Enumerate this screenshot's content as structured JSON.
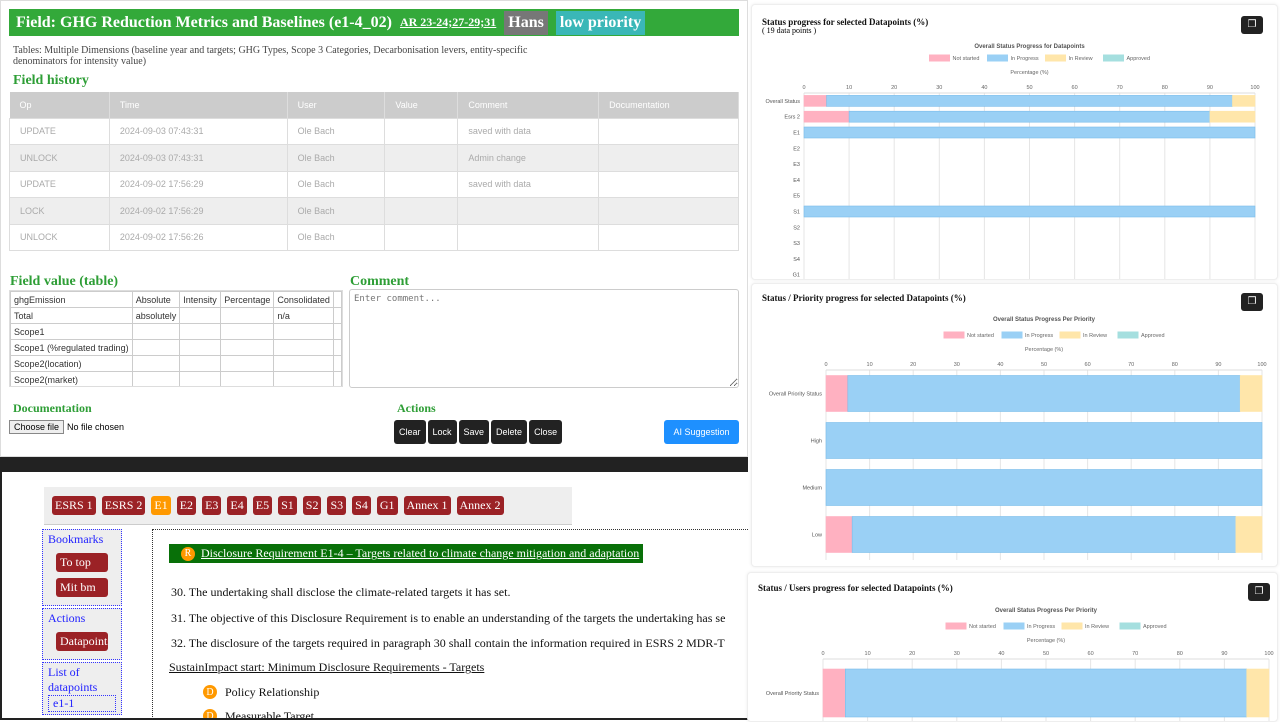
{
  "field": {
    "title": "Field: GHG Reduction Metrics and Baselines (e1-4_02)",
    "ar_ref": "AR 23-24;27-29;31",
    "user_badge": "Hans",
    "priority_badge": "low priority",
    "description": "Tables: Multiple Dimensions (baseline year and targets; GHG Types, Scope 3 Categories, Decarbonisation levers, entity-specific denominators for intensity value)"
  },
  "history": {
    "heading": "Field history",
    "columns": [
      "Op",
      "Time",
      "User",
      "Value",
      "Comment",
      "Documentation"
    ],
    "rows": [
      [
        "UPDATE",
        "2024-09-03 07:43:31",
        "Ole Bach",
        "",
        "saved with data",
        ""
      ],
      [
        "UNLOCK",
        "2024-09-03 07:43:31",
        "Ole Bach",
        "",
        "Admin change",
        ""
      ],
      [
        "UPDATE",
        "2024-09-02 17:56:29",
        "Ole Bach",
        "",
        "saved with data",
        ""
      ],
      [
        "LOCK",
        "2024-09-02 17:56:29",
        "Ole Bach",
        "",
        "",
        ""
      ],
      [
        "UNLOCK",
        "2024-09-02 17:56:26",
        "Ole Bach",
        "",
        "",
        ""
      ]
    ]
  },
  "value_table": {
    "heading": "Field value (table)",
    "rows": [
      [
        "ghgEmission",
        "Absolute",
        "Intensity",
        "Percentage",
        "Consolidated",
        ""
      ],
      [
        "Total",
        "absolutely",
        "",
        "",
        "n/a",
        ""
      ],
      [
        "Scope1",
        "",
        "",
        "",
        "",
        ""
      ],
      [
        "Scope1 (%regulated trading)",
        "",
        "",
        "",
        "",
        ""
      ],
      [
        "Scope2(location)",
        "",
        "",
        "",
        "",
        ""
      ],
      [
        "Scope2(market)",
        "",
        "",
        "",
        "",
        ""
      ]
    ]
  },
  "comment": {
    "heading": "Comment",
    "placeholder": "Enter comment..."
  },
  "documentation": {
    "heading": "Documentation",
    "choose_file": "Choose file",
    "no_file": "No file chosen"
  },
  "actions": {
    "heading": "Actions",
    "buttons": [
      "Clear",
      "Lock",
      "Save",
      "Delete",
      "Close"
    ],
    "ai": "AI Suggestion"
  },
  "nav": {
    "tabs": [
      "ESRS 1",
      "ESRS 2",
      "E1",
      "E2",
      "E3",
      "E4",
      "E5",
      "S1",
      "S2",
      "S3",
      "S4",
      "G1",
      "Annex 1",
      "Annex 2"
    ],
    "active": "E1"
  },
  "sidebar": {
    "bookmarks": "Bookmarks",
    "to_top": "To top",
    "mit_bm": "Mit bm",
    "actions": "Actions",
    "datapoints": "Datapoints",
    "list": "List of datapoints",
    "first_dp": "e1-1"
  },
  "document": {
    "requirement_marker": "R",
    "requirement": "Disclosure Requirement E1-4 – Targets related to climate change mitigation and adaptation",
    "paragraphs": [
      "30.  The undertaking shall disclose the climate-related targets it has set.",
      "31.  The objective of this Disclosure Requirement is to enable an understanding of the targets the undertaking has se",
      "32.  The disclosure of the targets required in paragraph 30 shall contain the information required in ESRS 2 MDR-T"
    ],
    "section": "SustainImpact start: Minimum Disclosure Requirements - Targets",
    "dp_marker": "D",
    "items": [
      "Policy Relationship",
      "Measurable Target"
    ]
  },
  "chart_data": [
    {
      "type": "bar",
      "orientation": "horizontal",
      "stacked": true,
      "card_title": "Status progress for selected Datapoints (%)",
      "subtitle": "( 19 data points )",
      "title": "Overall Status Progress for Datapoints",
      "xlabel": "Percentage (%)",
      "xlim": [
        0,
        100
      ],
      "xticks": [
        0,
        10,
        20,
        30,
        40,
        50,
        60,
        70,
        80,
        90,
        100
      ],
      "legend": "top",
      "grid": true,
      "categories": [
        "Overall Status",
        "Esrs 2",
        "E1",
        "E2",
        "E3",
        "E4",
        "E5",
        "S1",
        "S2",
        "S3",
        "S4",
        "G1"
      ],
      "series": [
        {
          "name": "Not started",
          "color": "#ffb1c1",
          "values": [
            5,
            10,
            0,
            0,
            0,
            0,
            0,
            0,
            0,
            0,
            0,
            0
          ]
        },
        {
          "name": "In Progress",
          "color": "#9ad0f5",
          "values": [
            90,
            80,
            100,
            0,
            0,
            0,
            0,
            100,
            0,
            0,
            0,
            0
          ]
        },
        {
          "name": "In Review",
          "color": "#ffe6aa",
          "values": [
            5,
            10,
            0,
            0,
            0,
            0,
            0,
            0,
            0,
            0,
            0,
            0
          ]
        },
        {
          "name": "Approved",
          "color": "#a5dfdf",
          "values": [
            0,
            0,
            0,
            0,
            0,
            0,
            0,
            0,
            0,
            0,
            0,
            0
          ]
        }
      ]
    },
    {
      "type": "bar",
      "orientation": "horizontal",
      "stacked": true,
      "card_title": "Status / Priority progress for selected Datapoints (%)",
      "title": "Overall Status Progress Per Priority",
      "xlabel": "Percentage (%)",
      "xlim": [
        0,
        100
      ],
      "xticks": [
        0,
        10,
        20,
        30,
        40,
        50,
        60,
        70,
        80,
        90,
        100
      ],
      "legend": "top",
      "grid": true,
      "categories": [
        "Overall Priority Status",
        "High",
        "Medium",
        "Low"
      ],
      "series": [
        {
          "name": "Not started",
          "color": "#ffb1c1",
          "values": [
            5,
            0,
            0,
            6
          ]
        },
        {
          "name": "In Progress",
          "color": "#9ad0f5",
          "values": [
            90,
            100,
            100,
            88
          ]
        },
        {
          "name": "In Review",
          "color": "#ffe6aa",
          "values": [
            5,
            0,
            0,
            6
          ]
        },
        {
          "name": "Approved",
          "color": "#a5dfdf",
          "values": [
            0,
            0,
            0,
            0
          ]
        }
      ]
    },
    {
      "type": "bar",
      "orientation": "horizontal",
      "stacked": true,
      "card_title": "Status / Users progress for selected Datapoints (%)",
      "title": "Overall Status Progress Per Priority",
      "xlabel": "Percentage (%)",
      "xlim": [
        0,
        100
      ],
      "xticks": [
        0,
        10,
        20,
        30,
        40,
        50,
        60,
        70,
        80,
        90,
        100
      ],
      "legend": "top",
      "grid": true,
      "categories": [
        "Overall Priority Status"
      ],
      "series": [
        {
          "name": "Not started",
          "color": "#ffb1c1",
          "values": [
            5
          ]
        },
        {
          "name": "In Progress",
          "color": "#9ad0f5",
          "values": [
            90
          ]
        },
        {
          "name": "In Review",
          "color": "#ffe6aa",
          "values": [
            5
          ]
        },
        {
          "name": "Approved",
          "color": "#a5dfdf",
          "values": [
            0
          ]
        }
      ]
    }
  ]
}
